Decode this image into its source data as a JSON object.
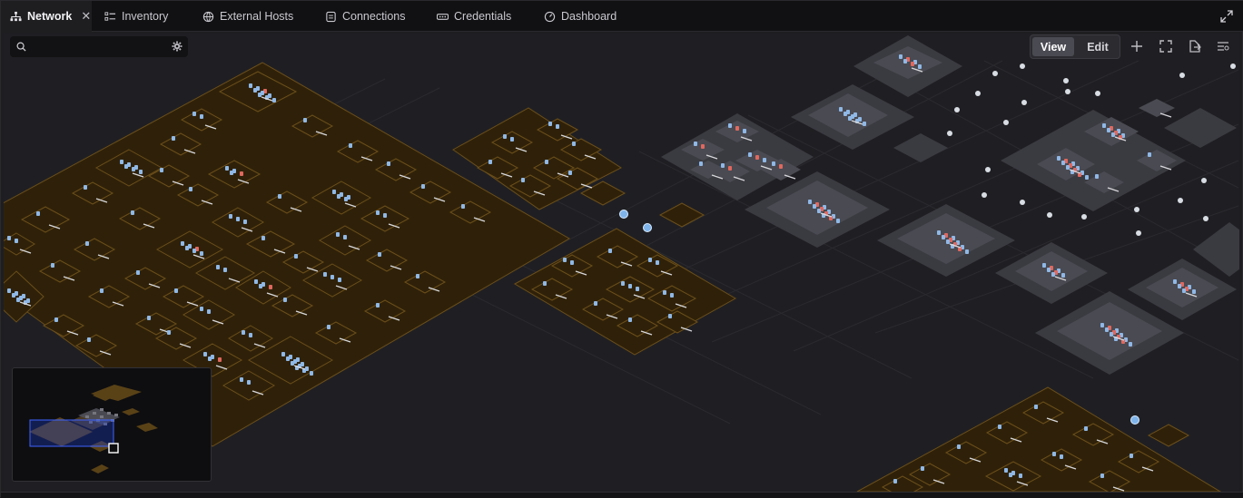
{
  "tabs": [
    {
      "label": "Network",
      "icon": "network-icon",
      "active": true
    },
    {
      "label": "Inventory",
      "icon": "list-icon"
    },
    {
      "label": "External Hosts",
      "icon": "globe-icon"
    },
    {
      "label": "Connections",
      "icon": "document-icon"
    },
    {
      "label": "Credentials",
      "icon": "key-icon"
    },
    {
      "label": "Dashboard",
      "icon": "gauge-icon"
    }
  ],
  "search": {
    "placeholder": "",
    "value": ""
  },
  "mode": {
    "view_label": "View",
    "edit_label": "Edit",
    "selected": "View"
  },
  "toolbar": [
    "add-icon",
    "fullscreen-icon",
    "export-icon",
    "filter-settings-icon"
  ],
  "colors": {
    "zone_fill": "#2f2109",
    "zone_border": "#6b4e1a",
    "group_fill": "#3a3a41",
    "group_inner": "#4a4a52",
    "canvas": "#1f1f23",
    "host_blue": "#8fb8e6",
    "host_red": "#e0685e"
  }
}
